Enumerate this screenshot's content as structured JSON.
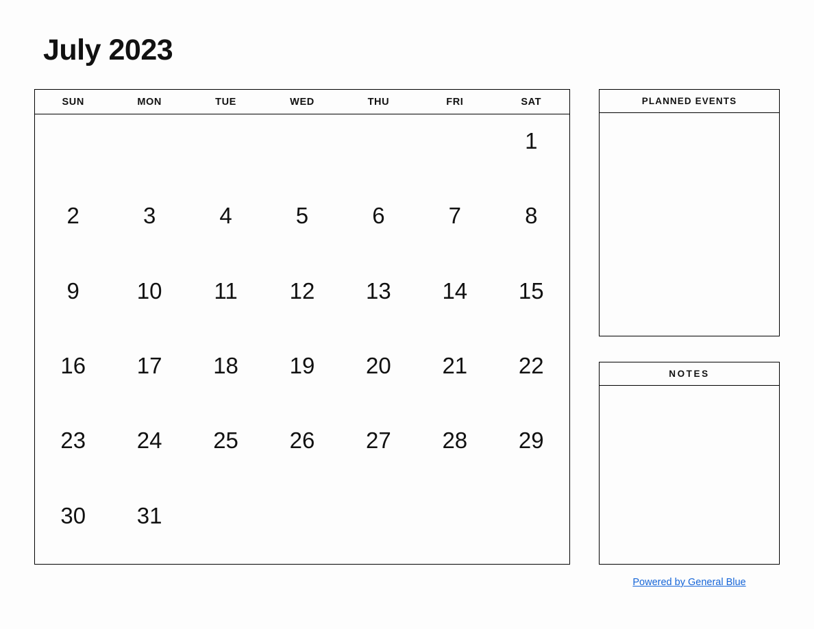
{
  "calendar": {
    "title": "July 2023",
    "month": "July",
    "year": "2023",
    "weekdays": [
      "SUN",
      "MON",
      "TUE",
      "WED",
      "THU",
      "FRI",
      "SAT"
    ],
    "weeks": [
      [
        "",
        "",
        "",
        "",
        "",
        "",
        "1"
      ],
      [
        "2",
        "3",
        "4",
        "5",
        "6",
        "7",
        "8"
      ],
      [
        "9",
        "10",
        "11",
        "12",
        "13",
        "14",
        "15"
      ],
      [
        "16",
        "17",
        "18",
        "19",
        "20",
        "21",
        "22"
      ],
      [
        "23",
        "24",
        "25",
        "26",
        "27",
        "28",
        "29"
      ],
      [
        "30",
        "31",
        "",
        "",
        "",
        "",
        ""
      ]
    ]
  },
  "panels": {
    "planned_events": {
      "title": "PLANNED EVENTS",
      "content": ""
    },
    "notes": {
      "title": "NOTES",
      "content": ""
    }
  },
  "footer": {
    "link_text": "Powered by General Blue",
    "link_color": "#1565d8"
  },
  "colors": {
    "background": "#fdfdfd",
    "border": "#000000",
    "text": "#111111",
    "link": "#1565d8"
  }
}
